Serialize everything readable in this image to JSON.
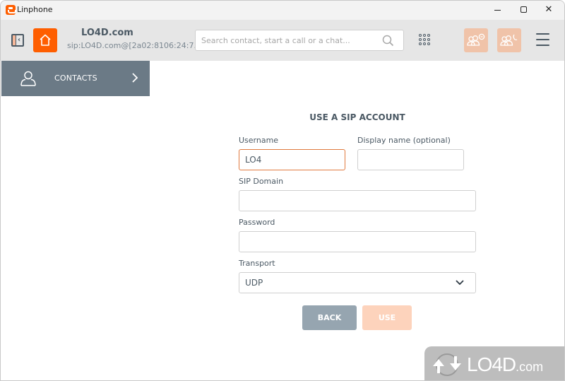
{
  "window": {
    "title": "Linphone",
    "controls": [
      "minimize",
      "maximize",
      "close"
    ]
  },
  "toolbar": {
    "account_name": "LO4D.com",
    "account_sip": "sip:LO4D.com@[2a02:8106:24:7...",
    "search_placeholder": "Search contact, start a call or a chat...",
    "icons": [
      "collapse-sidebar-icon",
      "home-icon",
      "search-icon",
      "dialpad-icon",
      "conference-chat-icon",
      "conference-call-icon",
      "hamburger-menu-icon"
    ]
  },
  "sidebar": {
    "contacts_label": "CONTACTS"
  },
  "form": {
    "title": "USE A SIP ACCOUNT",
    "username_label": "Username",
    "username_value": "LO4",
    "display_name_label": "Display name (optional)",
    "display_name_value": "",
    "sip_domain_label": "SIP Domain",
    "sip_domain_value": "",
    "password_label": "Password",
    "password_value": "",
    "transport_label": "Transport",
    "transport_value": "UDP",
    "back_label": "BACK",
    "use_label": "USE"
  },
  "colors": {
    "accent": "#fe5e00",
    "accent_disabled": "#fdd3bc",
    "sidebar": "#6b7a86",
    "back_button": "#96a5b0",
    "text": "#4b5964"
  },
  "watermark": {
    "text": "LO4D",
    "suffix": ".com"
  }
}
